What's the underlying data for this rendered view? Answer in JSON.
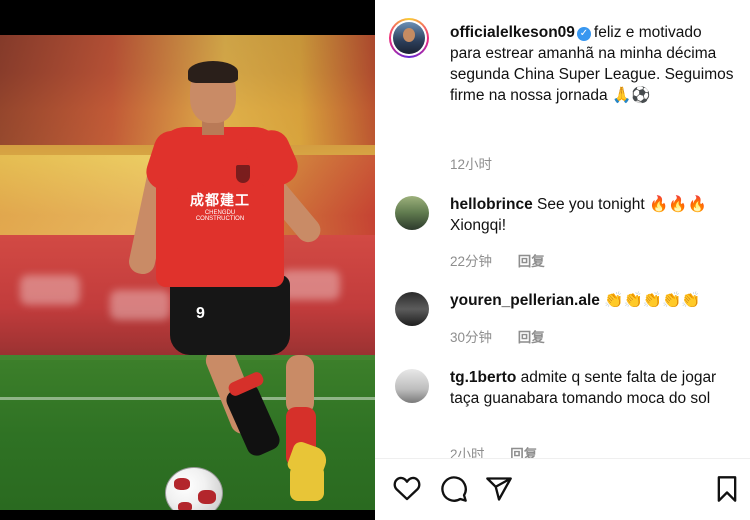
{
  "post": {
    "username": "officialelkeson09",
    "caption": "feliz e motivado para estrear amanhã na minha décima segunda China Super League. Seguimos firme na nossa jornada 🙏⚽️",
    "time": "12小时"
  },
  "photo": {
    "sponsor_text": "成都建工",
    "sponsor_subtext": "CHENGDU CONSTRUCTION",
    "shirt_number": "9"
  },
  "comments": [
    {
      "username": "hellobrince",
      "text": "See you tonight 🔥🔥🔥 Xiongqi!",
      "time": "22分钟",
      "reply_label": "回复"
    },
    {
      "username": "youren_pellerian.ale",
      "text": "👏👏👏👏👏",
      "time": "30分钟",
      "reply_label": "回复"
    },
    {
      "username": "tg.1berto",
      "text": "admite q sente falta de jogar taça guanabara tomando moca do sol",
      "time": "2小时",
      "reply_label": "回复"
    }
  ],
  "icons": {
    "like": "heart-icon",
    "comment": "comment-icon",
    "share": "send-icon",
    "save": "bookmark-icon",
    "verified": "verified-badge-icon"
  },
  "colors": {
    "verified": "#3897f0",
    "meta_text": "#8e8e8e",
    "jersey": "#e0322c"
  }
}
